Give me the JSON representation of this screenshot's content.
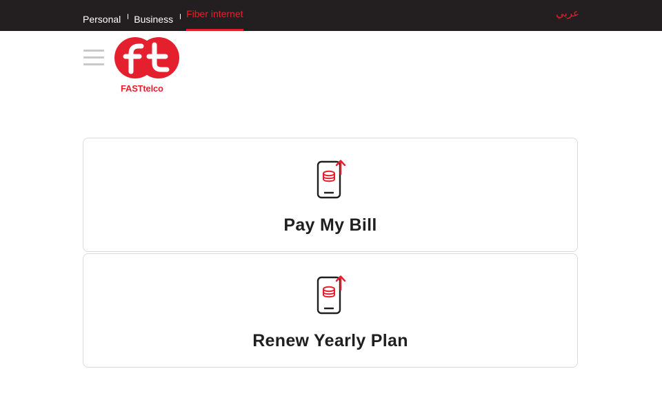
{
  "topbar": {
    "nav": [
      {
        "label": "Personal",
        "active": false
      },
      {
        "label": "Business",
        "active": false
      },
      {
        "label": "Fiber internet",
        "active": true
      }
    ],
    "language_label": "عربي"
  },
  "header": {
    "logo_text": "FASTtelco",
    "logo_mark": "ft"
  },
  "cards": [
    {
      "label": "Pay My Bill",
      "icon": "phone-coins-upload-icon"
    },
    {
      "label": "Renew Yearly Plan",
      "icon": "phone-coins-upload-icon"
    }
  ],
  "colors": {
    "brand_red": "#e4202e",
    "topbar_bg": "#231f20",
    "text": "#1f1f1f",
    "card_border": "#dadada"
  }
}
